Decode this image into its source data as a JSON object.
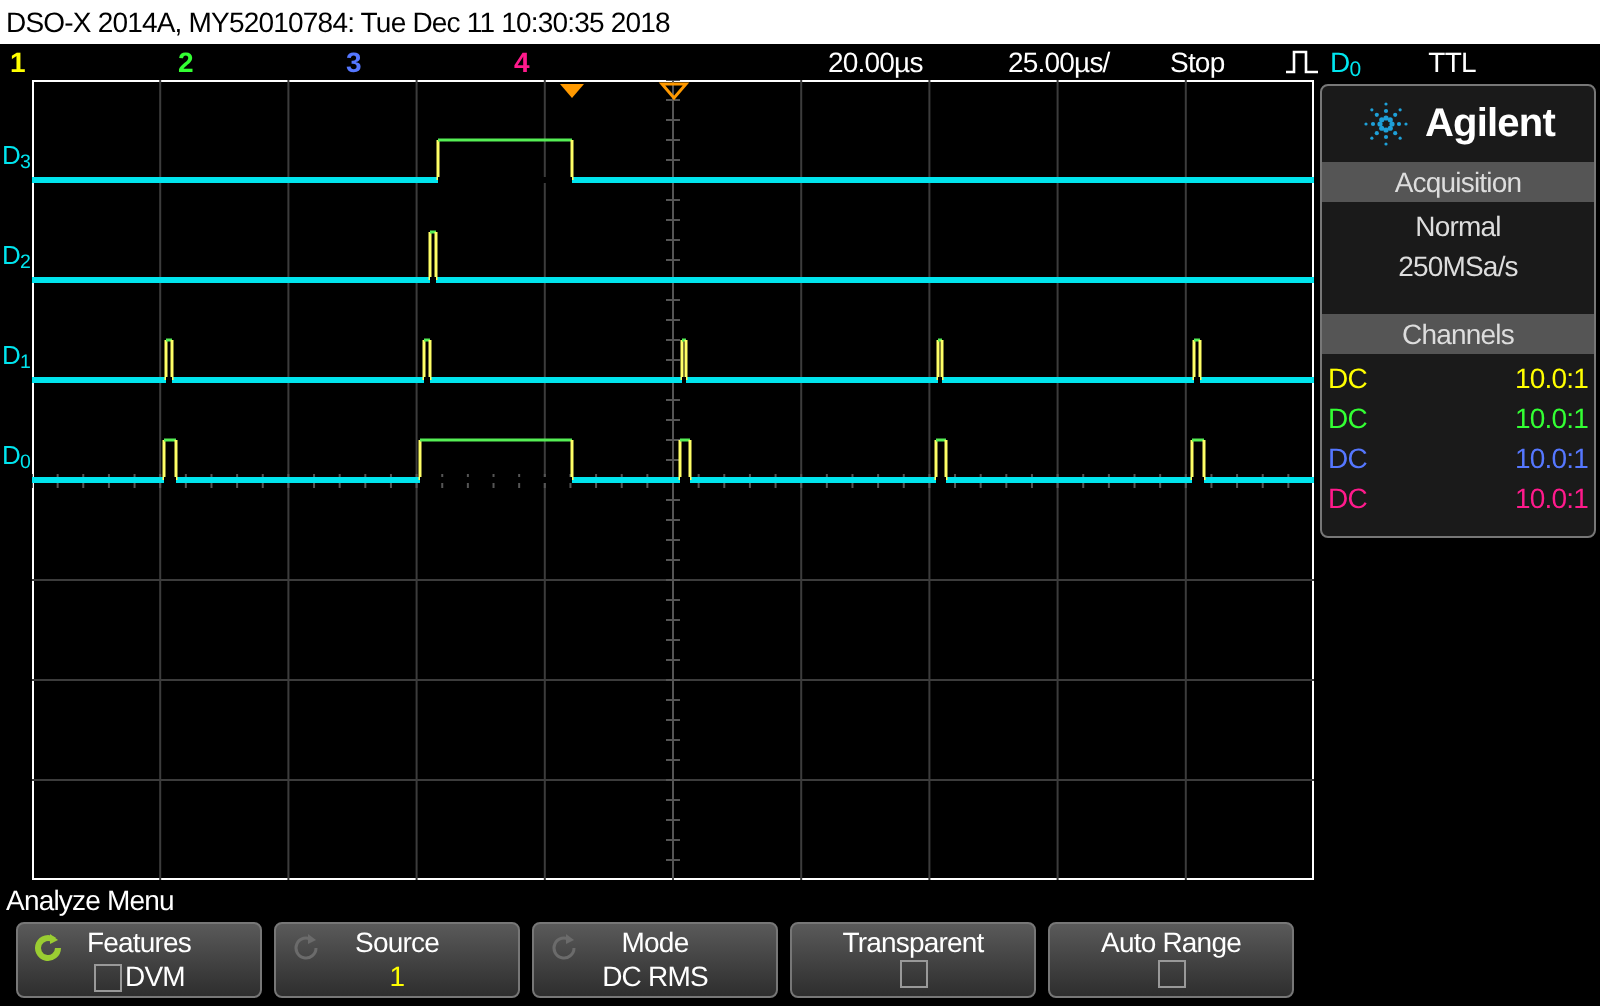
{
  "title_bar": "DSO-X 2014A, MY52010784: Tue Dec 11 10:30:35 2018",
  "status_bar": {
    "channels": [
      {
        "label": "1",
        "color": "#ffff00"
      },
      {
        "label": "2",
        "color": "#33ff33"
      },
      {
        "label": "3",
        "color": "#5577ff"
      },
      {
        "label": "4",
        "color": "#ff1a8c"
      }
    ],
    "delay": "20.00µs",
    "timebase": "25.00µs/",
    "run_state": "Stop",
    "trigger_source": "D$_{0}$",
    "trigger_level": "TTL"
  },
  "traces": [
    "D$_{3}$",
    "D$_{2}$",
    "D$_{1}$",
    "D$_{0}$"
  ],
  "panel": {
    "brand": "Agilent",
    "acquisition": {
      "title": "Acquisition",
      "mode": "Normal",
      "rate": "250MSa/s"
    },
    "channels": {
      "title": "Channels",
      "rows": [
        {
          "coupling": "DC",
          "probe": "10.0:1",
          "color": "#ffff00"
        },
        {
          "coupling": "DC",
          "probe": "10.0:1",
          "color": "#33ff33"
        },
        {
          "coupling": "DC",
          "probe": "10.0:1",
          "color": "#5577ff"
        },
        {
          "coupling": "DC",
          "probe": "10.0:1",
          "color": "#ff1a8c"
        }
      ]
    }
  },
  "menu": {
    "title": "Analyze Menu",
    "softkeys": [
      {
        "kind": "check",
        "label": "Features",
        "knob": true,
        "knob_active": true,
        "value": "DVM",
        "checked": false
      },
      {
        "kind": "value",
        "label": "Source",
        "knob": true,
        "knob_active": false,
        "value": "1",
        "color": "#ffff00"
      },
      {
        "kind": "value",
        "label": "Mode",
        "knob": true,
        "knob_active": false,
        "value": "DC RMS",
        "color": "#ffffff"
      },
      {
        "kind": "check",
        "label": "Transparent",
        "knob": false,
        "checked": false
      },
      {
        "kind": "check",
        "label": "Auto Range",
        "knob": false,
        "checked": false
      }
    ]
  }
}
